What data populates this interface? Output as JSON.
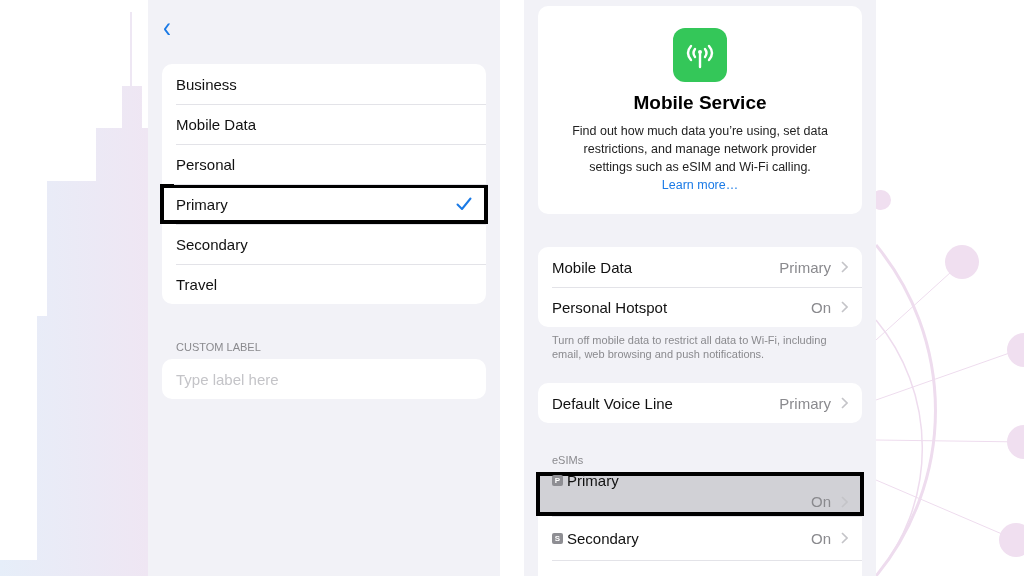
{
  "label_screen": {
    "back": "‹",
    "labels": [
      {
        "text": "Business",
        "selected": false,
        "highlighted": false
      },
      {
        "text": "Mobile Data",
        "selected": false,
        "highlighted": false
      },
      {
        "text": "Personal",
        "selected": false,
        "highlighted": false
      },
      {
        "text": "Primary",
        "selected": true,
        "highlighted": true
      },
      {
        "text": "Secondary",
        "selected": false,
        "highlighted": false
      },
      {
        "text": "Travel",
        "selected": false,
        "highlighted": false
      }
    ],
    "custom_label": {
      "header": "CUSTOM LABEL",
      "placeholder": "Type label here"
    }
  },
  "mobile_service": {
    "title": "Mobile Service",
    "description": "Find out how much data you’re using, set data restrictions, and manage network provider settings such as eSIM and Wi-Fi calling.",
    "link": "Learn more…",
    "group_1": [
      {
        "label": "Mobile Data",
        "value": "Primary"
      },
      {
        "label": "Personal Hotspot",
        "value": "On"
      }
    ],
    "footnote": "Turn off mobile data to restrict all data to Wi-Fi, including email, web browsing and push notifications.",
    "group_2": [
      {
        "label": "Default Voice Line",
        "value": "Primary"
      }
    ],
    "esims_header": "eSIMs",
    "esims": [
      {
        "badge": "P",
        "label": "Primary",
        "value": "On",
        "highlighted": true
      },
      {
        "badge": "S",
        "label": "Secondary",
        "value": "On",
        "highlighted": false
      }
    ]
  }
}
